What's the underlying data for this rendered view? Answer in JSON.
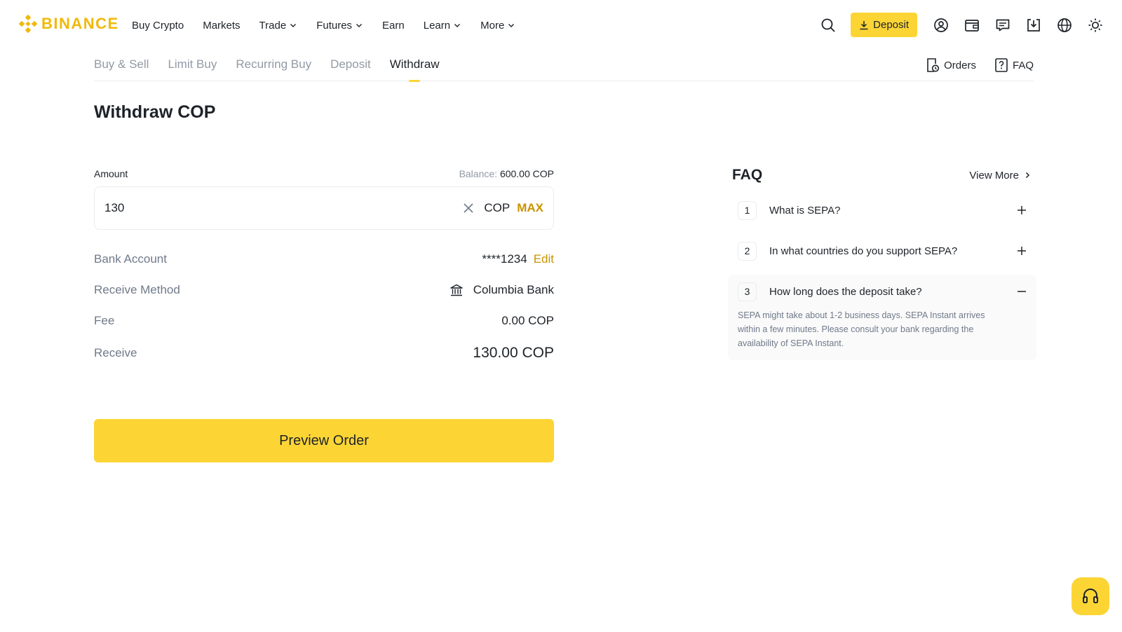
{
  "brand": {
    "name": "BINANCE",
    "color": "#f0b90b"
  },
  "nav": {
    "items": [
      {
        "label": "Buy Crypto",
        "dropdown": false
      },
      {
        "label": "Markets",
        "dropdown": false
      },
      {
        "label": "Trade",
        "dropdown": true
      },
      {
        "label": "Futures",
        "dropdown": true
      },
      {
        "label": "Earn",
        "dropdown": false
      },
      {
        "label": "Learn",
        "dropdown": true
      },
      {
        "label": "More",
        "dropdown": true
      }
    ],
    "deposit_label": "Deposit",
    "icons": [
      "search-icon",
      "user-icon",
      "wallet-icon",
      "message-icon",
      "download-icon",
      "globe-icon",
      "theme-icon"
    ]
  },
  "subtabs": {
    "tabs": [
      "Buy & Sell",
      "Limit Buy",
      "Recurring Buy",
      "Deposit",
      "Withdraw"
    ],
    "active": "Withdraw",
    "orders_label": "Orders",
    "faq_label": "FAQ"
  },
  "page": {
    "title": "Withdraw COP"
  },
  "form": {
    "amount_label": "Amount",
    "balance_label": "Balance:",
    "balance_value": "600.00 COP",
    "amount_value": "130",
    "currency": "COP",
    "max_label": "MAX",
    "bank_account_label": "Bank Account",
    "bank_account_value": "****1234",
    "edit_label": "Edit",
    "receive_method_label": "Receive Method",
    "receive_method_value": "Columbia Bank",
    "fee_label": "Fee",
    "fee_value": "0.00 COP",
    "receive_label": "Receive",
    "receive_value": "130.00 COP",
    "preview_label": "Preview Order"
  },
  "faq": {
    "title": "FAQ",
    "view_more": "View More",
    "items": [
      {
        "num": "1",
        "question": "What is SEPA?",
        "open": false,
        "answer": ""
      },
      {
        "num": "2",
        "question": "In what countries do you support SEPA?",
        "open": false,
        "answer": ""
      },
      {
        "num": "3",
        "question": "How long does the deposit take?",
        "open": true,
        "answer": "SEPA might take about 1-2 business days. SEPA Instant arrives within a few minutes. Please consult your bank regarding the availability of SEPA Instant."
      }
    ]
  },
  "colors": {
    "accent": "#fcd535",
    "link": "#c99400",
    "muted": "#707a8a",
    "text": "#1e2329"
  }
}
